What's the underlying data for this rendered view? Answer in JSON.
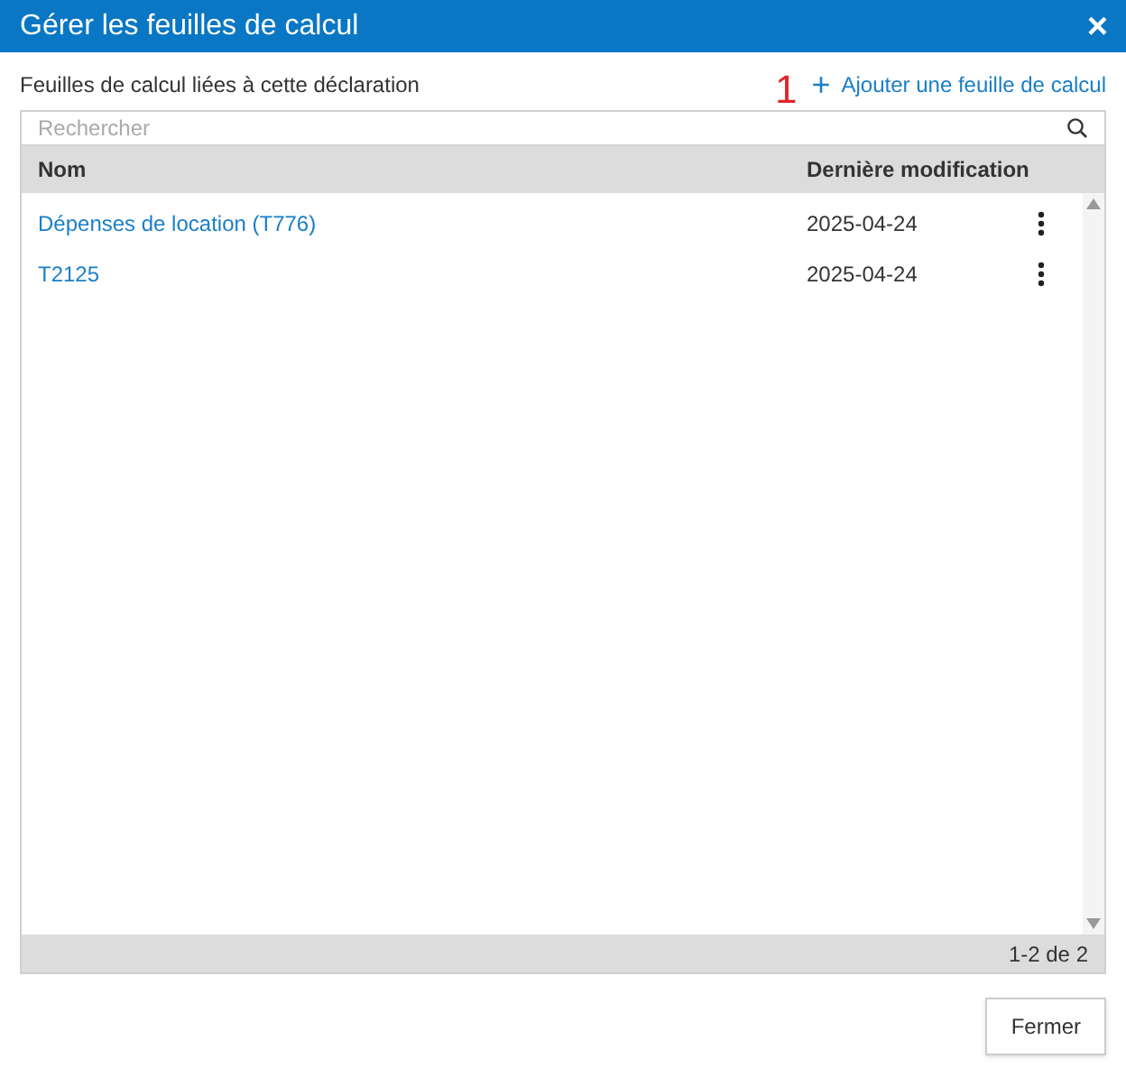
{
  "window": {
    "title": "Gérer les feuilles de calcul",
    "close": "×"
  },
  "subtitle": "Feuilles de calcul liées à cette déclaration",
  "annotation": "1",
  "add_link": {
    "icon": "+",
    "label": "Ajouter une feuille de calcul"
  },
  "search": {
    "placeholder": "Rechercher"
  },
  "table": {
    "columns": [
      "Nom",
      "Dernière modification"
    ],
    "rows": [
      {
        "name": "Dépenses de location (T776)",
        "modified": "2025-04-24"
      },
      {
        "name": "T2125",
        "modified": "2025-04-24"
      }
    ]
  },
  "pagination": "1-2 de 2",
  "buttons": [
    "Fermer"
  ]
}
